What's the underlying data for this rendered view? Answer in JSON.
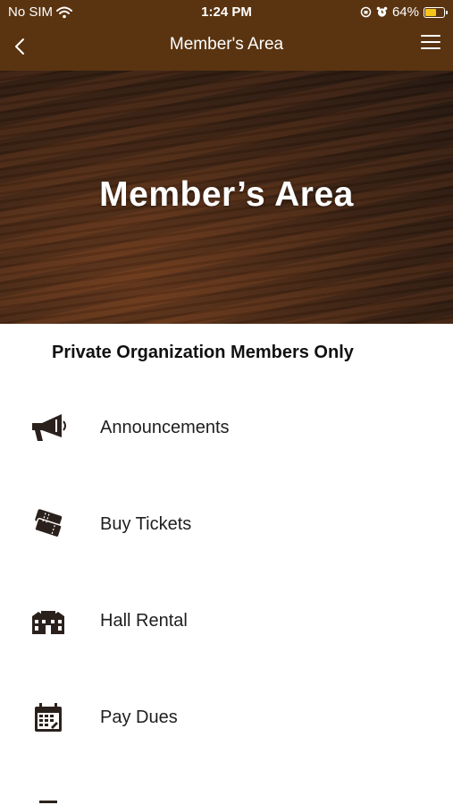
{
  "status_bar": {
    "carrier": "No SIM",
    "time": "1:24 PM",
    "battery": "64%",
    "battery_level": 0.64
  },
  "nav": {
    "title": "Member's Area",
    "back_icon": "chevron-left-icon",
    "menu_icon": "hamburger-menu-icon"
  },
  "hero": {
    "title": "Member’s Area"
  },
  "subtitle": "Private Organization Members Only",
  "menu": [
    {
      "label": "Announcements",
      "icon": "megaphone-icon"
    },
    {
      "label": "Buy Tickets",
      "icon": "tickets-icon"
    },
    {
      "label": "Hall Rental",
      "icon": "building-icon"
    },
    {
      "label": "Pay Dues",
      "icon": "calendar-icon"
    }
  ],
  "colors": {
    "header": "#5a3410",
    "icon": "#2b211c",
    "battery": "#f5c518"
  }
}
